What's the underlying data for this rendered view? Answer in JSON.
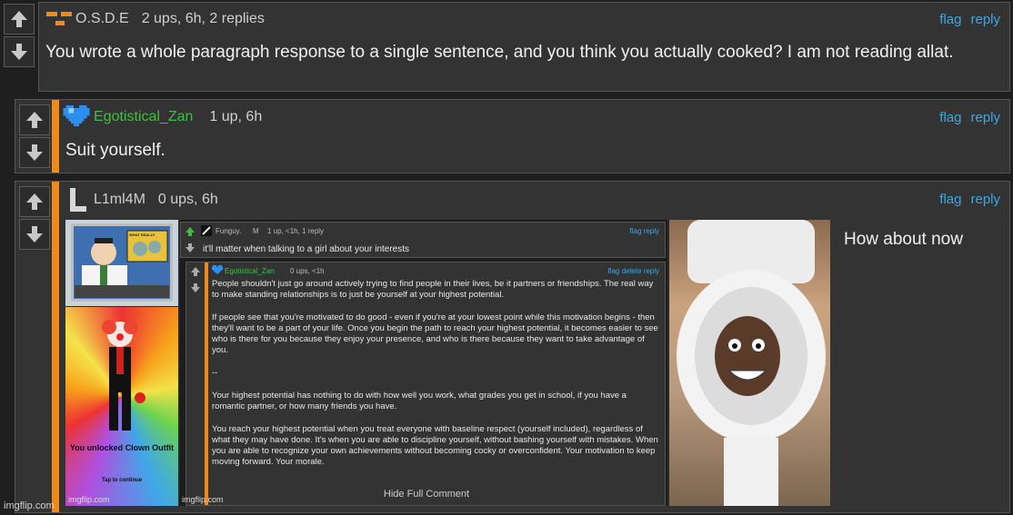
{
  "comments": [
    {
      "username": "O.S.D.E",
      "meta": "2 ups, 6h, 2 replies",
      "text": "You wrote a whole paragraph response to a single sentence, and you think you actually cooked? I am not reading allat.",
      "flag": "flag",
      "reply": "reply",
      "avatar_icon": "orange-face-icon"
    },
    {
      "username": "Egotistical_Zan",
      "meta": "1 up, 6h",
      "text": "Suit yourself.",
      "flag": "flag",
      "reply": "reply",
      "avatar_icon": "pixel-heart-icon",
      "username_color": "#3fbf3f"
    },
    {
      "username": "L1ml4M",
      "meta": "0 ups, 6h",
      "caption": "How about now",
      "flag": "flag",
      "reply": "reply",
      "avatar_icon": "letter-l-icon"
    }
  ],
  "embedded": {
    "meme_top_caption": "WHAT REALLY",
    "clown_text": "You unlocked Clown Outfit",
    "clown_sub": "Tap to continue",
    "watermark_left": "imgflip.com",
    "watermark_mid": "imgflip.com",
    "inner1": {
      "username": "Funguy.",
      "badge": "M",
      "meta": "1 up, <1h, 1 reply",
      "text": "it'll matter when talking to a girl about your interests",
      "flag": "flag",
      "reply": "reply"
    },
    "inner2": {
      "username": "Egotistical_Zan",
      "meta": "0 ups, <1h",
      "flag": "flag",
      "delete": "delete",
      "reply": "reply",
      "paragraphs": [
        "People shouldn't just go around actively trying to find people in their lives, be it partners or friendships. The real way to make standing relationships is to just be yourself at your highest potential.",
        "If people see that you're motivated to do good - even if you're at your lowest point while this motivation begins - then they'll want to be a part of your life. Once you begin the path to reach your highest potential, it becomes easier to see who is there for you because they enjoy your presence, and who is there because they want to take advantage of you.",
        "--",
        "Your highest potential has nothing to do with how well you work, what grades you get in school, if you have a romantic partner, or how many friends you have.",
        "You reach your highest potential when you treat everyone with baseline respect (yourself included), regardless of what they may have done. It's when you are able to discipline yourself, without bashing yourself with mistakes. When you are able to recognize your own achievements without becoming cocky or overconfident. Your motivation to keep moving forward. Your morale."
      ],
      "hide": "Hide Full Comment"
    }
  },
  "footer_watermark": "imgflip.com"
}
